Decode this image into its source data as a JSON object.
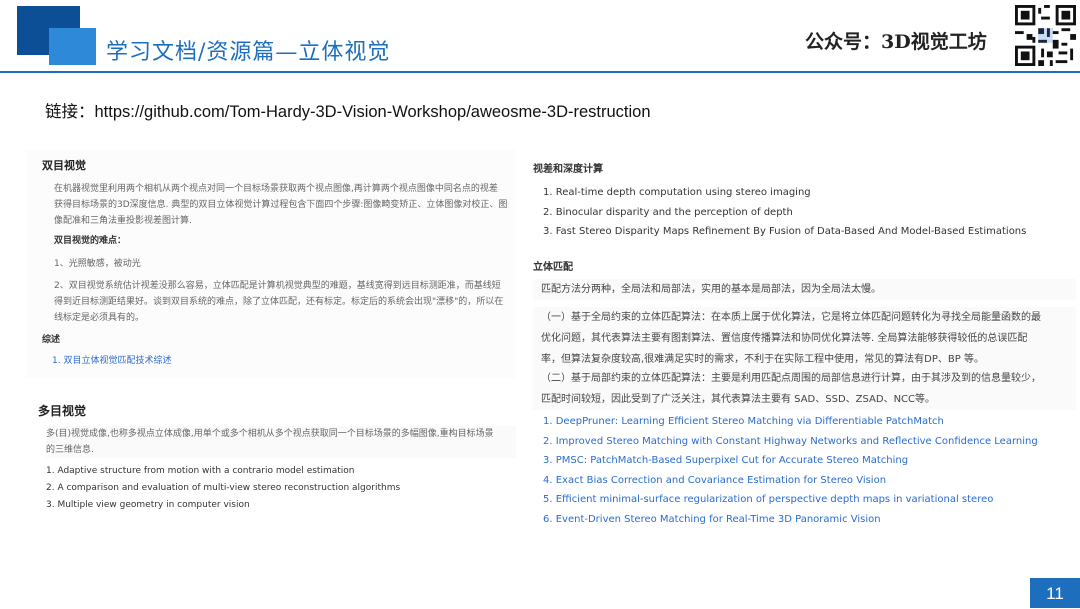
{
  "header": {
    "title": "学习文档/资源篇—立体视觉",
    "brand": "公众号：3D视觉工坊"
  },
  "link": {
    "label": "链接：",
    "url": "https://github.com/Tom-Hardy-3D-Vision-Workshop/aweosme-3D-restruction"
  },
  "binocular": {
    "heading": "双目视觉",
    "paragraph_lines": [
      "在机器视觉里利用两个相机从两个视点对同一个目标场景获取两个视点图像,再计算两个视点图像中同名点的视差",
      "获得目标场景的3D深度信息. 典型的双目立体视觉计算过程包含下面四个步骤:图像畸变矫正、立体图像对校正、图",
      "像配准和三角法重投影视差图计算."
    ],
    "difficulty_heading": "双目视觉的难点：",
    "difficulty_1": "1、光照敏感，被动光",
    "difficulty_2_lines": [
      "2、双目视觉系统估计视差没那么容易，立体匹配是计算机视觉典型的难题，基线宽得到远目标测距准，而基线短",
      "得到近目标测距结果好。谈到双目系统的难点，除了立体匹配，还有标定。标定后的系统会出现\"漂移\"的，所以在",
      "线标定是必须具有的。"
    ]
  },
  "review": {
    "heading": "综述",
    "item": "1. 双目立体视觉匹配技术综述"
  },
  "multiview": {
    "heading": "多目视觉",
    "paragraph_lines": [
      "多(目)视觉成像,也称多视点立体成像,用单个或多个相机从多个视点获取同一个目标场景的多幅图像,重构目标场景",
      "的三维信息."
    ],
    "items": [
      "1. Adaptive structure from motion with a contrario model estimation",
      "2. A comparison and evaluation of multi-view stereo reconstruction algorithms",
      "3. Multiple view geometry in computer vision"
    ]
  },
  "disparity": {
    "heading": "视差和深度计算",
    "items": [
      "1. Real-time depth computation using stereo imaging",
      "2. Binocular disparity and the perception of depth",
      "3. Fast Stereo Disparity Maps Refinement By Fusion of Data-Based And Model-Based Estimations"
    ]
  },
  "stereo": {
    "heading": "立体匹配",
    "intro": "匹配方法分两种，全局法和局部法，实用的基本是局部法，因为全局法太慢。",
    "global_lines": [
      "（一）基于全局约束的立体匹配算法：在本质上属于优化算法，它是将立体匹配问题转化为寻找全局能量函数的最",
      "优化问题，其代表算法主要有图割算法、置信度传播算法和协同优化算法等. 全局算法能够获得较低的总误匹配",
      "率，但算法复杂度较高,很难满足实时的需求，不利于在实际工程中使用，常见的算法有DP、BP 等。"
    ],
    "local_lines": [
      "（二）基于局部约束的立体匹配算法：主要是利用匹配点周围的局部信息进行计算，由于其涉及到的信息量较少，",
      "匹配时间较短，因此受到了广泛关注，其代表算法主要有 SAD、SSD、ZSAD、NCC等。"
    ],
    "items": [
      "1. DeepPruner: Learning Efficient Stereo Matching via Differentiable PatchMatch",
      "2. Improved Stereo Matching with Constant Highway Networks and Reflective Confidence Learning",
      "3. PMSC: PatchMatch-Based Superpixel Cut for Accurate Stereo Matching",
      "4. Exact Bias Correction and Covariance Estimation for Stereo Vision",
      "5. Efficient minimal-surface regularization of perspective depth maps in variational stereo",
      "6. Event-Driven Stereo Matching for Real-Time 3D Panoramic Vision"
    ]
  },
  "page_number": "11"
}
